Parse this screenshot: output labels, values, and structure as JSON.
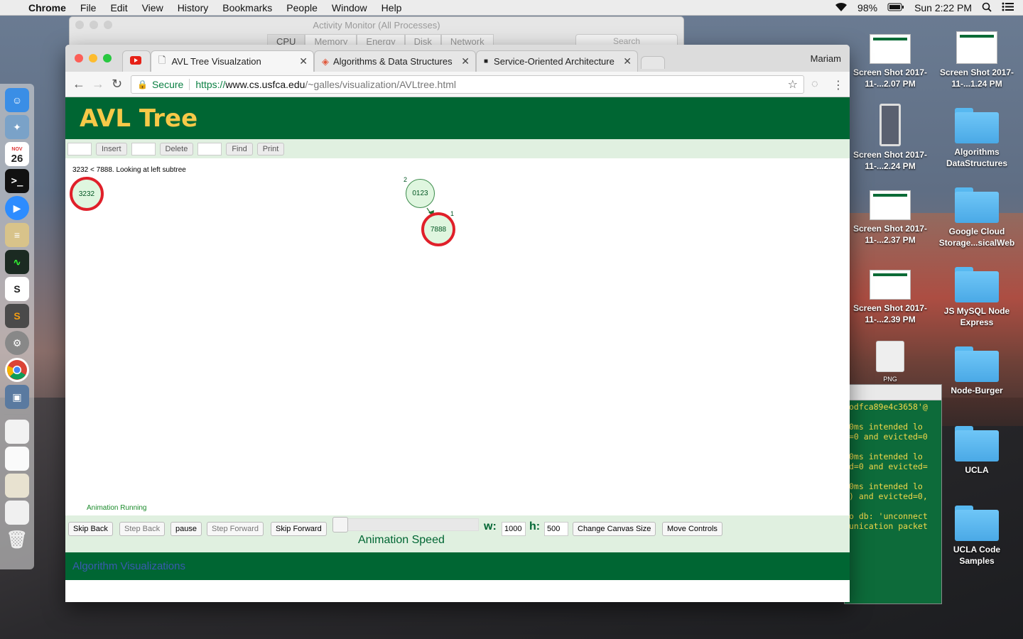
{
  "menubar": {
    "app": "Chrome",
    "items": [
      "File",
      "Edit",
      "View",
      "History",
      "Bookmarks",
      "People",
      "Window",
      "Help"
    ],
    "battery": "98%",
    "clock": "Sun 2:22 PM"
  },
  "dock": {
    "calendar_month": "NOV",
    "calendar_day": "26"
  },
  "desktop_icons": [
    {
      "label": "Screen Shot 2017-11-...2.07 PM"
    },
    {
      "label": "Screen Shot 2017-11-...1.24 PM"
    },
    {
      "label": "Screen Shot 2017-11-...2.24 PM"
    },
    {
      "label": "Algorithms DataStructures"
    },
    {
      "label": "Screen Shot 2017-11-...2.37 PM"
    },
    {
      "label": "Google Cloud Storage...sicalWeb"
    },
    {
      "label": "Screen Shot 2017-11-...2.39 PM"
    },
    {
      "label": "JS MySQL Node Express"
    },
    {
      "label": "PNG"
    },
    {
      "label": "Node-Burger"
    },
    {
      "label": "UCLA"
    },
    {
      "label": "UCLA Code Samples"
    }
  ],
  "activity_monitor": {
    "title": "Activity Monitor (All Processes)",
    "tabs": [
      "CPU",
      "Memory",
      "Energy",
      "Disk",
      "Network"
    ],
    "search_placeholder": "Search"
  },
  "terminal": {
    "lines": "odfca89e4c3658'@\n\n0ms intended lo\n=0 and evicted=0\n\n0ms intended lo\nd=0 and evicted=\n\n0ms intended lo\n) and evicted=0,\n\no db: 'unconnect\nunication packet"
  },
  "browser": {
    "tabs": [
      {
        "label": "AVL Tree Visualzation"
      },
      {
        "label": "Algorithms & Data Structures"
      },
      {
        "label": "Service-Oriented Architecture"
      }
    ],
    "profile": "Mariam",
    "secure_label": "Secure",
    "url_scheme": "https://",
    "url_host": "www.cs.usfca.edu",
    "url_path": "/~galles/visualization/AVLtree.html"
  },
  "page": {
    "title": "AVL Tree",
    "controls": {
      "insert": "Insert",
      "delete": "Delete",
      "find": "Find",
      "print": "Print"
    },
    "message": "3232 < 7888.  Looking at left subtree",
    "nodes": [
      {
        "label": "3232",
        "highlighted": true,
        "height": ""
      },
      {
        "label": "0123",
        "highlighted": false,
        "height": "2"
      },
      {
        "label": "7888",
        "highlighted": true,
        "height": "1"
      }
    ],
    "status": "Animation Running",
    "animation": {
      "skip_back": "Skip Back",
      "step_back": "Step Back",
      "pause": "pause",
      "step_forward": "Step Forward",
      "skip_forward": "Skip Forward",
      "speed_label": "Animation Speed",
      "w_label": "w:",
      "w_value": "1000",
      "h_label": "h:",
      "h_value": "500",
      "change_canvas": "Change Canvas Size",
      "move_controls": "Move Controls"
    },
    "footer": "Algorithm Visualizations"
  },
  "colors": {
    "usf_green": "#006633",
    "title_gold": "#f7c948",
    "highlight_red": "#e0202a",
    "node_fill": "#dff6df"
  }
}
